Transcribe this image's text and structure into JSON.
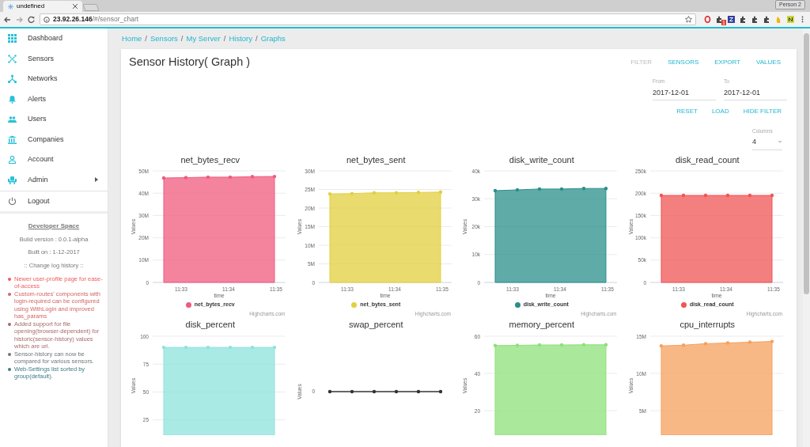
{
  "browser": {
    "tab_title": "undefined",
    "address_host": "23.92.26.146",
    "address_path": "/#/sensor_chart",
    "profile": "Person 2",
    "extension_badge": "1"
  },
  "sidebar": {
    "items": [
      {
        "label": "Dashboard",
        "has_submenu": false
      },
      {
        "label": "Sensors",
        "has_submenu": false
      },
      {
        "label": "Networks",
        "has_submenu": false
      },
      {
        "label": "Alerts",
        "has_submenu": false
      },
      {
        "label": "Users",
        "has_submenu": false
      },
      {
        "label": "Companies",
        "has_submenu": false
      },
      {
        "label": "Account",
        "has_submenu": false
      },
      {
        "label": "Admin",
        "has_submenu": true
      }
    ],
    "logout": "Logout",
    "developer": {
      "title": "Developer Space",
      "build_version": "Build version : 0.0.1-alpha",
      "built_on": "Built on : 1-12-2017",
      "changelog_title": ":: Change log history ::",
      "changelog": [
        {
          "text": "Newer user-profile page for ease-of-access",
          "color": "#ef5b5b"
        },
        {
          "text": "Custom-routes' components with login-required can be configured using WithLogin and improved has_params",
          "color": "#d46464"
        },
        {
          "text": "Added support for file opening(browser-dependent) for historic(sensor-history) values which are url.",
          "color": "#a86a6a"
        },
        {
          "text": "Sensor-history can now be compared for various sensors.",
          "color": "#6f7777"
        },
        {
          "text": "Web-Settings list sorted by group(default).",
          "color": "#3f7c86"
        }
      ]
    }
  },
  "breadcrumb": {
    "separator": "/",
    "items": [
      "Home",
      "Sensors",
      "My Server",
      "History",
      "Graphs"
    ]
  },
  "page": {
    "title": "Sensor History( Graph )",
    "actions": [
      {
        "label": "FILTER",
        "disabled": true
      },
      {
        "label": "SENSORS",
        "disabled": false
      },
      {
        "label": "EXPORT",
        "disabled": false
      },
      {
        "label": "VALUES",
        "disabled": false
      }
    ],
    "from": {
      "label": "From",
      "value": "2017-12-01"
    },
    "to": {
      "label": "To",
      "value": "2017-12-01"
    },
    "filter_buttons": [
      "RESET",
      "LOAD",
      "HIDE FILTER"
    ],
    "columns": {
      "label": "Columns",
      "value": "4"
    }
  },
  "charts": [
    {
      "title": "net_bytes_recv",
      "credits": "Highcharts.com",
      "time_labels": [
        "11:33",
        "11:34",
        "11:35"
      ],
      "chart_data": {
        "type": "area",
        "xlabel": "time",
        "ylabel": "Values",
        "grid": true,
        "categories": [
          null,
          null,
          null,
          null,
          null,
          null
        ],
        "series": [
          {
            "name": "net_bytes_recv",
            "color": "#f05a7e",
            "values": [
              46800000,
              47000000,
              47200000,
              47200000,
              47400000,
              47500000
            ]
          }
        ],
        "ylim": [
          0,
          50000000
        ],
        "yticks": [
          {
            "value": 0,
            "label": "0"
          },
          {
            "value": 10000000,
            "label": "10M"
          },
          {
            "value": 20000000,
            "label": "20M"
          },
          {
            "value": 30000000,
            "label": "30M"
          },
          {
            "value": 40000000,
            "label": "40M"
          },
          {
            "value": 50000000,
            "label": "50M"
          }
        ]
      }
    },
    {
      "title": "net_bytes_sent",
      "credits": "Highcharts.com",
      "time_labels": [
        "11:33",
        "11:34",
        "11:35"
      ],
      "chart_data": {
        "type": "area",
        "xlabel": "time",
        "ylabel": "Values",
        "grid": true,
        "categories": [
          null,
          null,
          null,
          null,
          null,
          null
        ],
        "series": [
          {
            "name": "net_bytes_sent",
            "color": "#e3cf3f",
            "values": [
              23800000,
              23900000,
              24100000,
              24100000,
              24200000,
              24300000
            ]
          }
        ],
        "ylim": [
          0,
          30000000
        ],
        "yticks": [
          {
            "value": 0,
            "label": "0"
          },
          {
            "value": 5000000,
            "label": "5M"
          },
          {
            "value": 10000000,
            "label": "10M"
          },
          {
            "value": 15000000,
            "label": "15M"
          },
          {
            "value": 20000000,
            "label": "20M"
          },
          {
            "value": 25000000,
            "label": "25M"
          },
          {
            "value": 30000000,
            "label": "30M"
          }
        ]
      }
    },
    {
      "title": "disk_write_count",
      "credits": "Highcharts.com",
      "time_labels": [
        "11:33",
        "11:34",
        "11:35"
      ],
      "chart_data": {
        "type": "area",
        "xlabel": "time",
        "ylabel": "Values",
        "grid": true,
        "categories": [
          null,
          null,
          null,
          null,
          null,
          null
        ],
        "series": [
          {
            "name": "disk_write_count",
            "color": "#2a8f8a",
            "values": [
              32900,
              33200,
              33500,
              33500,
              33700,
              33700
            ]
          }
        ],
        "ylim": [
          0,
          40000
        ],
        "yticks": [
          {
            "value": 0,
            "label": "0"
          },
          {
            "value": 10000,
            "label": "10k"
          },
          {
            "value": 20000,
            "label": "20k"
          },
          {
            "value": 30000,
            "label": "30k"
          },
          {
            "value": 40000,
            "label": "40k"
          }
        ]
      }
    },
    {
      "title": "disk_read_count",
      "credits": "Highcharts.com",
      "time_labels": [
        "11:33",
        "11:34",
        "11:35"
      ],
      "chart_data": {
        "type": "area",
        "xlabel": "time",
        "ylabel": "Values",
        "grid": true,
        "categories": [
          null,
          null,
          null,
          null,
          null,
          null
        ],
        "series": [
          {
            "name": "disk_read_count",
            "color": "#f05454",
            "values": [
              195000,
              195000,
              195000,
              195000,
              195000,
              195000
            ]
          }
        ],
        "ylim": [
          0,
          250000
        ],
        "yticks": [
          {
            "value": 0,
            "label": "0"
          },
          {
            "value": 50000,
            "label": "50k"
          },
          {
            "value": 100000,
            "label": "100k"
          },
          {
            "value": 150000,
            "label": "150k"
          },
          {
            "value": 200000,
            "label": "200k"
          },
          {
            "value": 250000,
            "label": "250k"
          }
        ]
      }
    },
    {
      "title": "disk_percent",
      "chart_data": {
        "type": "area",
        "ylabel": "Values",
        "grid": true,
        "categories": [
          null,
          null,
          null,
          null,
          null,
          null
        ],
        "series": [
          {
            "color": "#8ee3dc",
            "values": [
              90,
              90,
              90,
              90,
              90,
              90
            ]
          }
        ],
        "ylim": [
          0,
          100
        ],
        "yticks": [
          25,
          50,
          75,
          100
        ]
      }
    },
    {
      "title": "swap_percent",
      "flat_chart": {
        "ylabel": "Values",
        "tick_label": "0"
      }
    },
    {
      "title": "memory_percent",
      "chart_data": {
        "type": "area",
        "ylabel": "Values",
        "grid": true,
        "categories": [
          null,
          null,
          null,
          null,
          null,
          null
        ],
        "series": [
          {
            "color": "#8ee07a",
            "values": [
              55,
              55.1,
              55.3,
              55.3,
              55.4,
              55.4
            ]
          }
        ],
        "ylim": [
          0,
          60
        ],
        "yticks": [
          20,
          40,
          60
        ]
      }
    },
    {
      "title": "cpu_interrupts",
      "chart_data": {
        "type": "area",
        "ylabel": "Values",
        "grid": true,
        "categories": [
          null,
          null,
          null,
          null,
          null,
          null
        ],
        "series": [
          {
            "color": "#f5a05e",
            "values": [
              13700000,
              13800000,
              14000000,
              14100000,
              14200000,
              14300000
            ]
          }
        ],
        "ylim": [
          0,
          15000000
        ],
        "yticks": [
          {
            "value": 5000000,
            "label": "5M"
          },
          {
            "value": 10000000,
            "label": "10M"
          },
          {
            "value": 15000000,
            "label": "15M"
          }
        ]
      }
    }
  ]
}
